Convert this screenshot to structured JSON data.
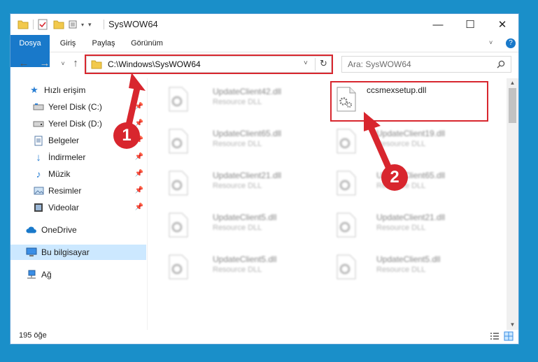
{
  "window": {
    "title": "SysWOW64"
  },
  "ribbon": {
    "tabs": [
      "Dosya",
      "Giriş",
      "Paylaş",
      "Görünüm"
    ]
  },
  "address": {
    "path": "C:\\Windows\\SysWOW64"
  },
  "search": {
    "placeholder": "Ara: SysWOW64"
  },
  "sidebar": {
    "quick_access": "Hızlı erişim",
    "items": [
      {
        "label": "Yerel Disk (C:)"
      },
      {
        "label": "Yerel Disk (D:)"
      },
      {
        "label": "Belgeler"
      },
      {
        "label": "İndirmeler"
      },
      {
        "label": "Müzik"
      },
      {
        "label": "Resimler"
      },
      {
        "label": "Videolar"
      }
    ],
    "onedrive": "OneDrive",
    "this_pc": "Bu bilgisayar",
    "network": "Ağ"
  },
  "files": {
    "left": [
      {
        "name": "UpdateClient42.dll",
        "type": "Resource DLL"
      },
      {
        "name": "UpdateClient65.dll",
        "type": "Resource DLL"
      },
      {
        "name": "UpdateClient21.dll",
        "type": "Resource DLL"
      },
      {
        "name": "UpdateClient5.dll",
        "type": "Resource DLL"
      },
      {
        "name": "UpdateClient5.dll",
        "type": "Resource DLL"
      }
    ],
    "highlighted": {
      "name": "ccsmexsetup.dll"
    },
    "right": [
      {
        "name": "UpdateClient19.dll",
        "type": "Resource DLL"
      },
      {
        "name": "UpdateClient65.dll",
        "type": "Resource DLL"
      },
      {
        "name": "UpdateClient21.dll",
        "type": "Resource DLL"
      },
      {
        "name": "UpdateClient5.dll",
        "type": "Resource DLL"
      }
    ]
  },
  "status": {
    "count": "195 öğe"
  },
  "annotations": {
    "badge1": "1",
    "badge2": "2"
  },
  "colors": {
    "accent": "#1979ca",
    "highlight": "#d8262e",
    "desktop": "#1a8fc9"
  }
}
